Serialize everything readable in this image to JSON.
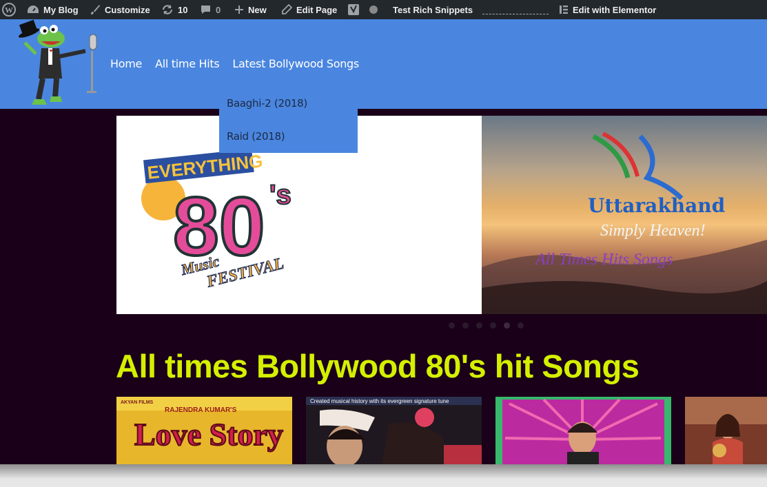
{
  "adminbar": {
    "site_name": "My Blog",
    "customize": "Customize",
    "updates_count": "10",
    "comments_count": "0",
    "new_label": "New",
    "edit_page": "Edit Page",
    "rich_snippets": "Test Rich Snippets",
    "elementor": "Edit with Elementor"
  },
  "nav": {
    "items": [
      "Home",
      "All time Hits",
      "Latest Bollywood Songs"
    ],
    "dropdown": [
      "Baaghi-2 (2018)",
      "Raid (2018)"
    ]
  },
  "slider": {
    "slide1": {
      "line1": "EVERYTHING",
      "big": "80",
      "suffix": "'s",
      "line2": "Music",
      "line3": "FESTIVAL"
    },
    "slide2": {
      "title": "Uttarakhand",
      "tagline": "Simply Heaven!",
      "caption": "All Times Hits Songs"
    },
    "dots_count": 6,
    "active_dot": 4
  },
  "main": {
    "section_title": "All times Bollywood 80's hit Songs",
    "albums": [
      {
        "top_text": "RAJENDRA KUMAR'S",
        "studio": "AKYAN FILMS",
        "title": "Love Story"
      },
      {
        "top_text": "Created musical history with its evergreen signature tune",
        "title": ""
      },
      {
        "top_text": "",
        "title": ""
      },
      {
        "top_text": "",
        "title": ""
      }
    ]
  },
  "colors": {
    "header_blue": "#4a86df",
    "title_yellow": "#d4f000",
    "page_bg": "#1a0018",
    "adminbar": "#23282d"
  }
}
